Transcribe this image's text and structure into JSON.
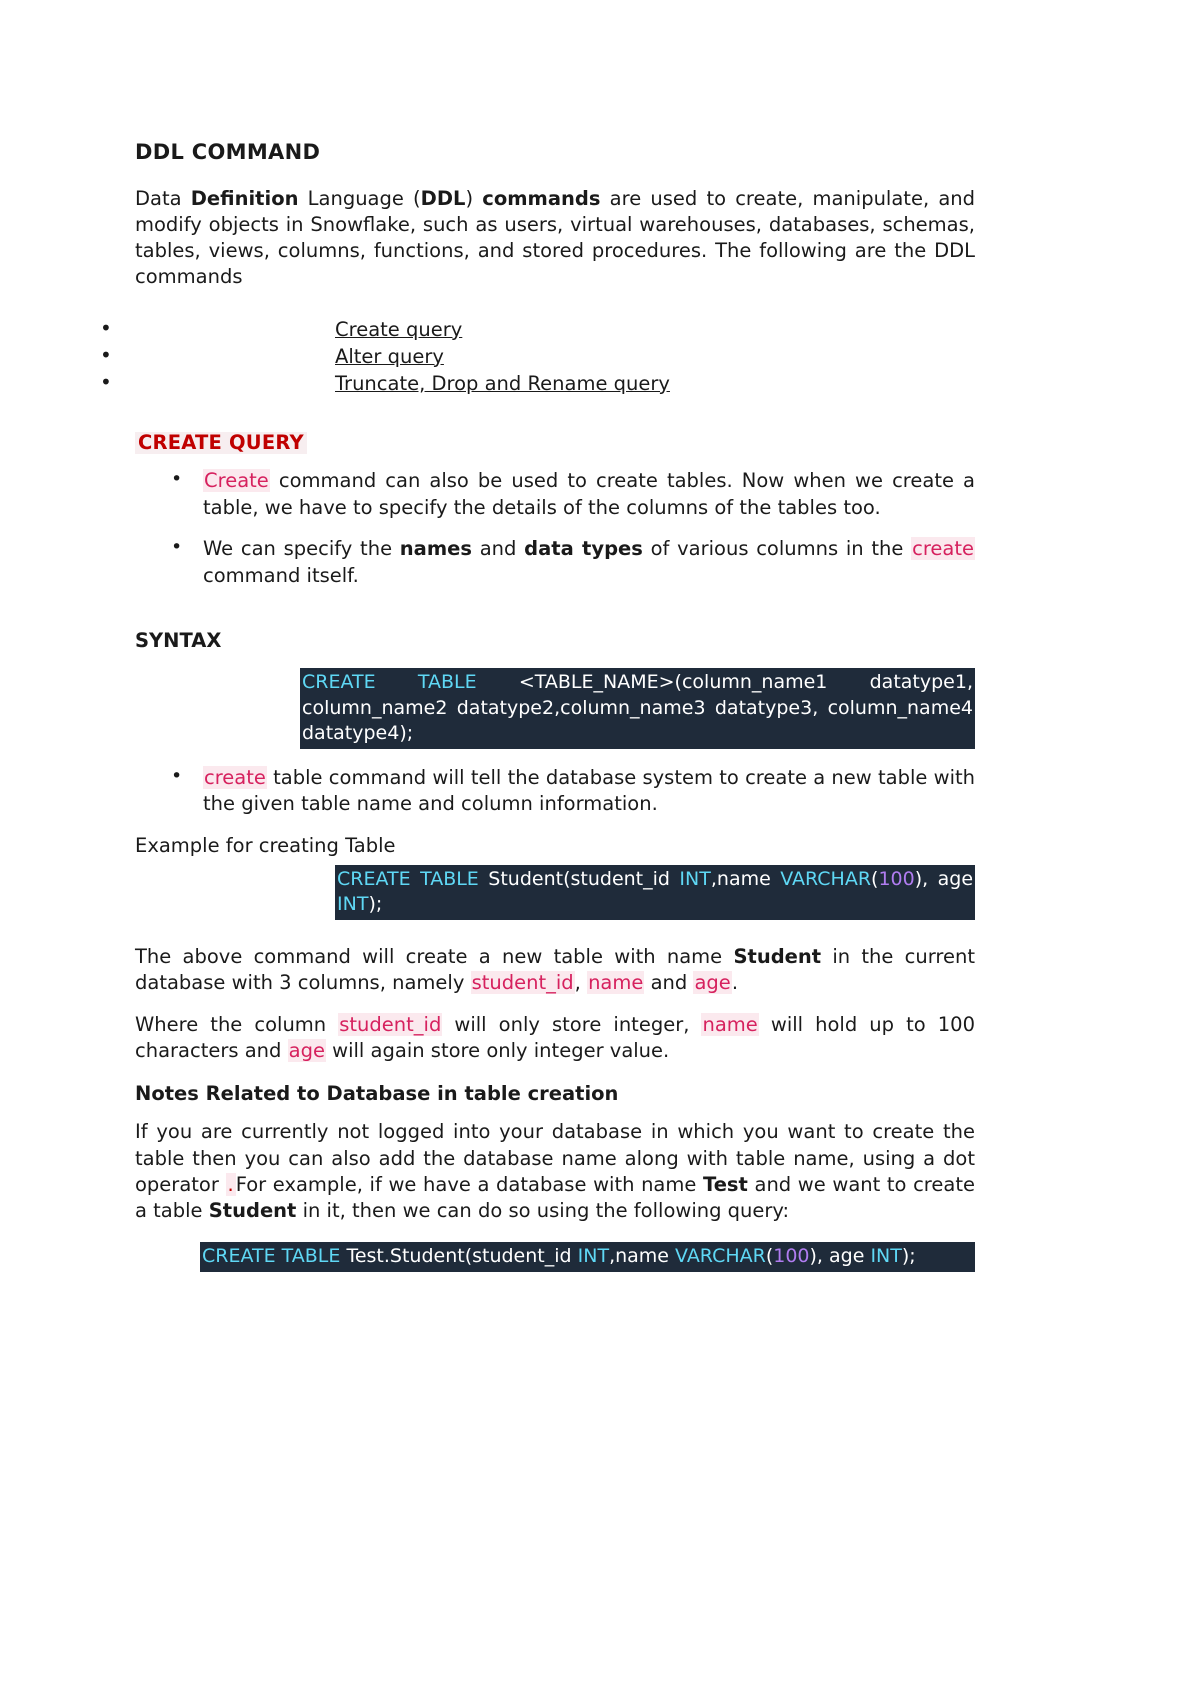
{
  "document": {
    "title": "DDL COMMAND",
    "intro": {
      "t1": "Data ",
      "b1": "Definition",
      "t2": " Language    (",
      "b2": "DDL",
      "t3": ") ",
      "b3": "commands",
      "t4": " are used to create, manipulate, and modify objects in Snowflake, such as users, virtual warehouses, databases, schemas, tables, views, columns, functions, and stored procedures. The following are the DDL commands"
    },
    "command_list": [
      "Create query",
      "Alter query",
      "Truncate, Drop and Rename query"
    ],
    "create_query_section": {
      "heading": "CREATE QUERY",
      "bullets": [
        {
          "kw": "Create",
          "rest": " command can also be used to create tables. Now when we create a table, we have to specify the details of the columns of the tables too."
        }
      ],
      "bullet2": {
        "p1": "We can specify the ",
        "b1": "names",
        "p2": " and ",
        "b2": "data types",
        "p3": " of various columns in the ",
        "kw": "create",
        "p4": " command itself."
      },
      "syntax_heading": "SYNTAX",
      "syntax_code": {
        "kw1": "CREATE TABLE",
        "rest": " <TABLE_NAME>(column_name1 datatype1, column_name2    datatype2,column_name3    datatype3, column_name4 datatype4);"
      },
      "bullet3": {
        "kw": "create",
        "rest": " table command will tell the database system to create a new table with the given table name and column information."
      },
      "example_label": "Example for creating Table",
      "example_code": {
        "kw1": "CREATE",
        "sp1": "        ",
        "kw2": "TABLE",
        "sp2": "        ",
        "id1": "Student(student_id",
        "sp3": "        ",
        "kw3": "INT",
        "id2": ",name ",
        "kw4": "VARCHAR",
        "p1": "(",
        "num1": "100",
        "p2": "),     age ",
        "kw5": "INT",
        "p3": ");"
      },
      "explain1": {
        "t1": "The above command will create a new table with name ",
        "b1": "Student",
        "t2": " in the current database with 3 columns, namely ",
        "k1": "student_id",
        "t3": ", ",
        "k2": "name",
        "t4": " and ",
        "k3": "age",
        "t5": "."
      },
      "explain2": {
        "t1": "Where the column ",
        "k1": "student_id",
        "t2": " will only store integer, ",
        "k2": "name",
        "t3": " will hold up to 100 characters and ",
        "k3": "age",
        "t4": " will again store only integer value."
      },
      "notes_heading": "Notes Related to Database in table creation",
      "notes_body": {
        "t1": "If you are currently not logged into your database in which you want to create the table then you can also add the database name along with table name, using a dot operator ",
        "dot": ".",
        "t2": "For example, if we have a database with name ",
        "b1": "Test",
        "t3": " and we want to create a table ",
        "b2": "Student",
        "t4": " in it, then we can do so using the following query:"
      },
      "final_code": {
        "kw1": "CREATE  TABLE",
        "id1": "  Test.Student(student_id  ",
        "kw2": "INT",
        "id2": ",name  ",
        "kw3": "VARCHAR",
        "p1": "(",
        "num1": "100",
        "p2": "), age ",
        "kw4": "INT",
        "p3": ");"
      }
    }
  },
  "colors": {
    "code_bg": "#1f2b3a",
    "code_keyword": "#5fd8f5",
    "code_number": "#b07cf0",
    "heading_red": "#c00000",
    "inline_keyword": "#d6215e",
    "inline_keyword_bg": "#fbe9ee"
  }
}
